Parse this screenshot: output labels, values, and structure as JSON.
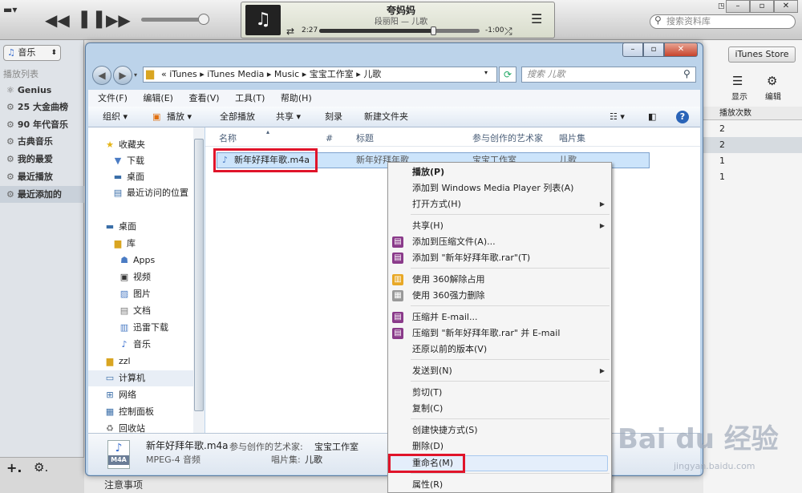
{
  "itunes": {
    "now_playing": {
      "title": "夸妈妈",
      "subtitle": "段丽阳 — 儿歌",
      "elapsed": "2:27",
      "remaining": "-1:00",
      "progress": 0.71
    },
    "volume": 0.92,
    "search_placeholder": "搜索资料库",
    "source_select": "音乐",
    "playlists_header": "播放列表",
    "playlists": [
      "Genius",
      "25 大金曲榜",
      "90 年代音乐",
      "古典音乐",
      "我的最爱",
      "最近播放",
      "最近添加的"
    ],
    "store_button": "iTunes Store",
    "right_tools": {
      "display": "显示",
      "edit": "编辑"
    },
    "play_count_header": "播放次数",
    "play_counts": [
      "2",
      "2",
      "1",
      "1"
    ],
    "bottom_note": "注意事项"
  },
  "explorer": {
    "address": {
      "prefix": "«",
      "crumbs": [
        "iTunes",
        "iTunes Media",
        "Music",
        "宝宝工作室",
        "儿歌"
      ]
    },
    "search_placeholder": "搜索 儿歌",
    "menubar": [
      "文件(F)",
      "编辑(E)",
      "查看(V)",
      "工具(T)",
      "帮助(H)"
    ],
    "commands": {
      "organize": "组织 ▾",
      "play": "播放 ▾",
      "play_all": "全部播放",
      "share": "共享 ▾",
      "burn": "刻录",
      "new_folder": "新建文件夹"
    },
    "nav": {
      "favorites": "收藏夹",
      "fav_items": [
        "下载",
        "桌面",
        "最近访问的位置"
      ],
      "desktop": "桌面",
      "library": "库",
      "lib_items": [
        "Apps",
        "视频",
        "图片",
        "文档",
        "迅雷下载",
        "音乐"
      ],
      "zzl": "zzl",
      "computer": "计算机",
      "network": "网络",
      "control_panel": "控制面板",
      "recycle": "回收站"
    },
    "columns": {
      "name": "名称",
      "number": "#",
      "title": "标题",
      "artist": "参与创作的艺术家",
      "album": "唱片集"
    },
    "file": {
      "name": "新年好拜年歌.m4a",
      "title": "新年好拜年歌",
      "artist": "宝宝工作室",
      "album": "儿歌"
    },
    "details": {
      "name": "新年好拜年歌.m4a",
      "type": "MPEG-4 音频",
      "artist_label": "参与创作的艺术家:",
      "artist": "宝宝工作室",
      "album_label": "唱片集:",
      "album": "儿歌",
      "icon_text": "M4A"
    }
  },
  "context_menu": {
    "play": "播放(P)",
    "add_wmp": "添加到 Windows Media Player 列表(A)",
    "open_with": "打开方式(H)",
    "share": "共享(H)",
    "add_archive": "添加到压缩文件(A)...",
    "add_rar": "添加到 \"新年好拜年歌.rar\"(T)",
    "unlock360": "使用 360解除占用",
    "delete360": "使用 360强力删除",
    "compress_email": "压缩并 E-mail...",
    "compress_rar_email": "压缩到 \"新年好拜年歌.rar\" 并 E-mail",
    "restore": "还原以前的版本(V)",
    "send_to": "发送到(N)",
    "cut": "剪切(T)",
    "copy": "复制(C)",
    "shortcut": "创建快捷方式(S)",
    "delete": "删除(D)",
    "rename": "重命名(M)",
    "properties": "属性(R)"
  },
  "watermark": {
    "main": "Bai du 经验",
    "sub": "jingyan.baidu.com"
  }
}
